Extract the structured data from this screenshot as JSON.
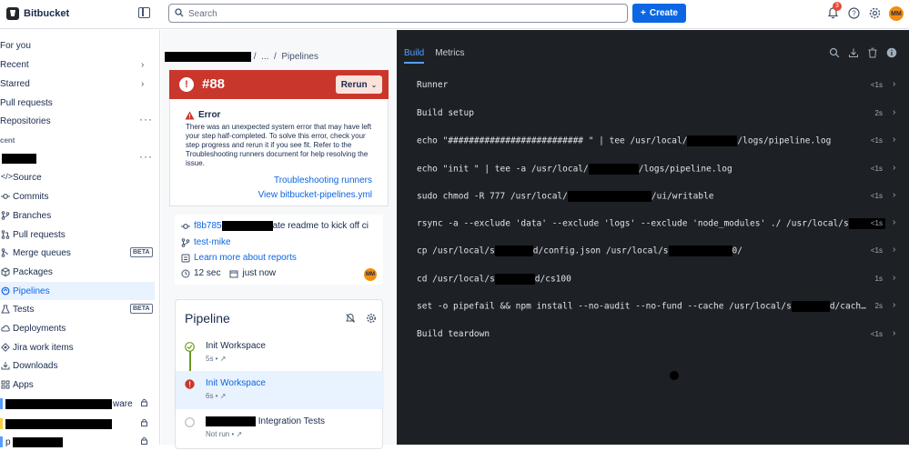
{
  "topbar": {
    "brand": "Bitbucket",
    "search_placeholder": "Search",
    "create_label": "Create",
    "notification_count": "3",
    "avatar_initials": "MM"
  },
  "sidebar": {
    "top_items": [
      {
        "label": "For you"
      },
      {
        "label": "Recent"
      },
      {
        "label": "Starred"
      },
      {
        "label": "Pull requests"
      },
      {
        "label": "Repositories"
      }
    ],
    "section_label": "cent",
    "repo_items": [
      {
        "label": "Source"
      },
      {
        "label": "Commits"
      },
      {
        "label": "Branches"
      },
      {
        "label": "Pull requests"
      },
      {
        "label": "Merge queues",
        "badge": "BETA"
      },
      {
        "label": "Packages"
      },
      {
        "label": "Pipelines"
      },
      {
        "label": "Tests",
        "badge": "BETA"
      },
      {
        "label": "Deployments"
      },
      {
        "label": "Jira work items"
      },
      {
        "label": "Downloads"
      },
      {
        "label": "Apps"
      }
    ],
    "repo_list": [
      {
        "suffix": "ware"
      },
      {
        "suffix": ""
      },
      {
        "suffix": "p"
      }
    ]
  },
  "breadcrumb": {
    "ellipsis": "...",
    "current": "Pipelines",
    "sep": "/"
  },
  "build": {
    "number": "#88",
    "rerun_label": "Rerun",
    "error_title": "Error",
    "error_body": "There was an unexpected system error that may have left your step half-completed. To solve this error, check your step progress and rerun it if you see fit. Refer to the Troubleshooting runners document for help resolving the issue.",
    "link_troubleshoot": "Troubleshooting runners",
    "link_yml": "View bitbucket-pipelines.yml",
    "commit_hash": "f8b785",
    "commit_msg_suffix": "ate readme to kick off ci",
    "branch": "test-mike",
    "reports_link": "Learn more about reports",
    "duration": "12 sec",
    "when": "just now",
    "author_initials": "MM"
  },
  "pipeline": {
    "title": "Pipeline",
    "steps": [
      {
        "name": "Init Workspace",
        "meta": "5s",
        "status": "success"
      },
      {
        "name": "Init Workspace",
        "meta": "6s",
        "status": "error"
      },
      {
        "name": "Integration Tests",
        "meta": "Not run",
        "status": "pending"
      }
    ]
  },
  "log_panel": {
    "tabs": [
      "Build",
      "Metrics"
    ],
    "active_tab": "Build",
    "rows": [
      {
        "pre": "Runner",
        "post": "",
        "dur": "<1s"
      },
      {
        "pre": "Build setup",
        "post": "",
        "dur": "2s"
      },
      {
        "pre": "echo \"########################## \" | tee /usr/local/",
        "post": "/logs/pipeline.log",
        "dur": "<1s"
      },
      {
        "pre": "echo \"init \" | tee -a /usr/local/",
        "post": "/logs/pipeline.log",
        "dur": "<1s"
      },
      {
        "pre": "sudo chmod -R 777 /usr/local/",
        "post": "/ui/writable",
        "dur": "<1s"
      },
      {
        "pre": "rsync -a --exclude 'data' --exclude 'logs' --exclude 'node_modules' ./ /usr/local/s",
        "post": "",
        "dur": "<1s"
      },
      {
        "pre": "cp /usr/local/s",
        "mid": "d/config.json /usr/local/s",
        "post": "0/",
        "dur": "<1s"
      },
      {
        "pre": "cd /usr/local/s",
        "post": "d/cs100",
        "dur": "1s"
      },
      {
        "pre": "set -o pipefail && npm install --no-audit --no-fund --cache /usr/local/s",
        "post": "d/cach…",
        "dur": "2s"
      },
      {
        "pre": "Build teardown",
        "post": "",
        "dur": "<1s"
      }
    ]
  }
}
